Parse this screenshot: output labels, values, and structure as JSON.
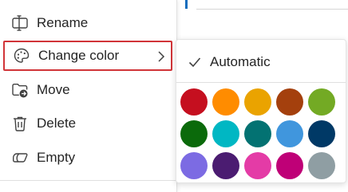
{
  "menu": {
    "items": [
      {
        "label": "Rename",
        "icon": "rename-icon"
      },
      {
        "label": "Change color",
        "icon": "palette-icon"
      },
      {
        "label": "Move",
        "icon": "folder-move-icon"
      },
      {
        "label": "Delete",
        "icon": "trash-icon"
      },
      {
        "label": "Empty",
        "icon": "eraser-icon"
      }
    ]
  },
  "submenu": {
    "automatic_label": "Automatic",
    "colors": [
      "#c50f1f",
      "#ff8c00",
      "#eaa300",
      "#a4400d",
      "#73aa24",
      "#0b6a0b",
      "#00b7c3",
      "#037272",
      "#4096dd",
      "#003966",
      "#7c6be3",
      "#4b1c71",
      "#e43ba6",
      "#bf0077",
      "#8f9ea3"
    ]
  },
  "theme": {
    "highlight_border": "#d13438",
    "text": "#242424"
  }
}
